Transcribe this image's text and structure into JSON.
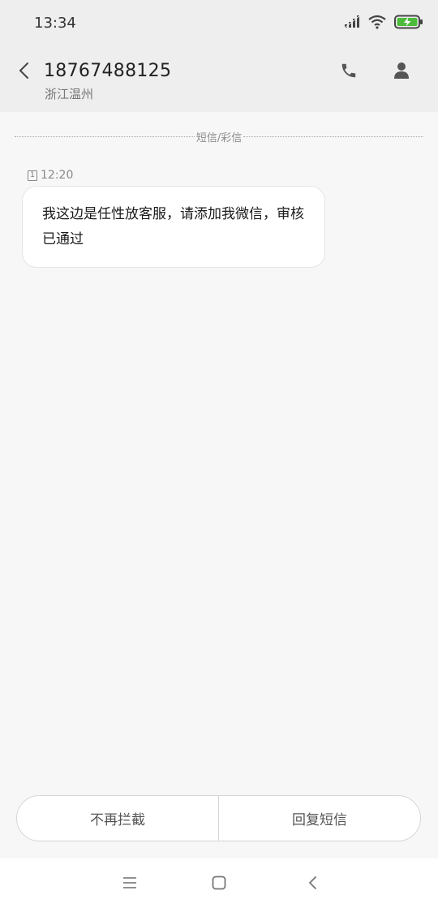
{
  "status_bar": {
    "time": "13:34",
    "icons": [
      "signal-icon",
      "wifi-icon",
      "battery-charging-icon"
    ],
    "battery_color": "#4cbb3b"
  },
  "header": {
    "phone_number": "18767488125",
    "location": "浙江温州",
    "back_icon": "chevron-left-icon",
    "call_icon": "phone-icon",
    "profile_icon": "person-icon"
  },
  "conversation": {
    "divider_label": "短信/彩信",
    "messages": [
      {
        "sim": "1",
        "time": "12:20",
        "text": "我这边是任性放客服，请添加我微信，审核已通过"
      }
    ]
  },
  "actions": {
    "left_label": "不再拦截",
    "right_label": "回复短信"
  },
  "nav": {
    "icons": [
      "menu-icon",
      "home-icon",
      "back-icon"
    ]
  }
}
